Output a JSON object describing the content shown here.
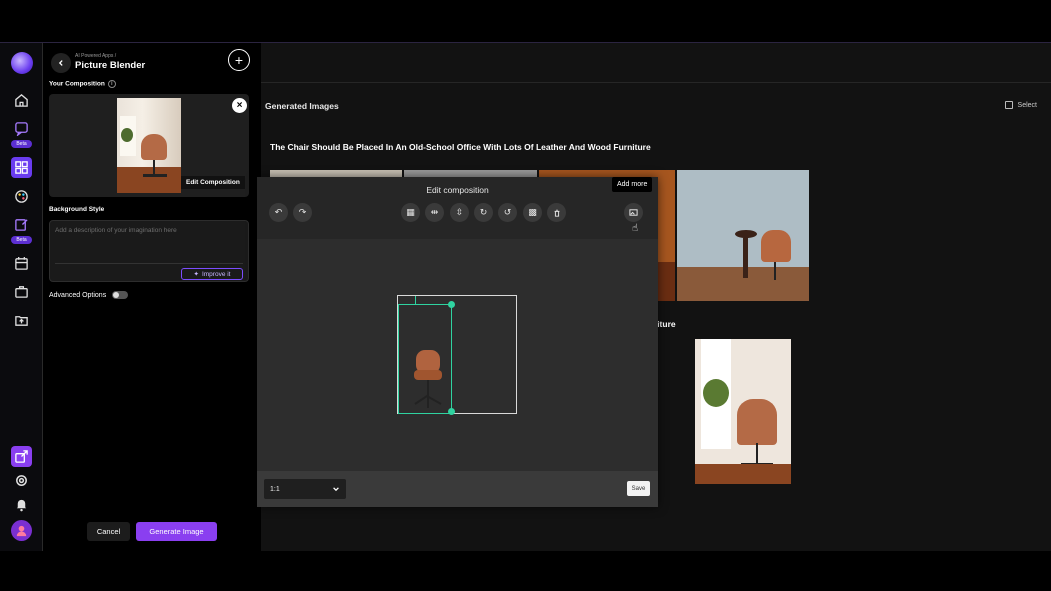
{
  "app": {
    "breadcrumb": "AI Powered Apps /",
    "title": "Picture Blender"
  },
  "rail": {
    "items": [
      {
        "icon": "home-icon"
      },
      {
        "icon": "chat-sparkle-icon",
        "badge": "Beta"
      },
      {
        "icon": "apps-grid-icon"
      },
      {
        "icon": "palette-icon"
      },
      {
        "icon": "edit-square-icon",
        "badge": "Beta"
      },
      {
        "icon": "calendar-icon"
      },
      {
        "icon": "briefcase-icon"
      },
      {
        "icon": "folder-upload-icon"
      }
    ],
    "bottom": [
      {
        "icon": "share-icon"
      },
      {
        "icon": "settings-icon"
      },
      {
        "icon": "bell-icon"
      },
      {
        "icon": "user-avatar-icon"
      }
    ],
    "accent": "#8a3ff0"
  },
  "panel": {
    "composition_label": "Your Composition",
    "edit_composition": "Edit Composition",
    "background_style_label": "Background Style",
    "description_placeholder": "Add a description of your imagination here",
    "improve_label": "Improve it",
    "advanced_options_label": "Advanced Options",
    "advanced_options_on": false,
    "cancel_label": "Cancel",
    "generate_label": "Generate Image"
  },
  "main": {
    "generated_title": "Generated Images",
    "select_label": "Select",
    "prompt_1": "The Chair Should Be Placed In An Old-School Office With Lots Of Leather And Wood Furniture",
    "prompt_2_fragment": "niture"
  },
  "modal": {
    "title": "Edit composition",
    "tooltip": "Add more",
    "toolbar": {
      "undo": "undo-icon",
      "redo": "redo-icon",
      "grid": "grid-icon",
      "flip_h": "flip-horizontal-icon",
      "flip_v": "flip-vertical-icon",
      "rotate_cw": "rotate-cw-icon",
      "rotate_ccw": "rotate-ccw-icon",
      "remove_bg": "remove-background-icon",
      "delete": "trash-icon",
      "add_image": "add-image-icon"
    },
    "ratio_value": "1:1",
    "save_label": "Save",
    "layer_color": "#2fd3a0"
  }
}
